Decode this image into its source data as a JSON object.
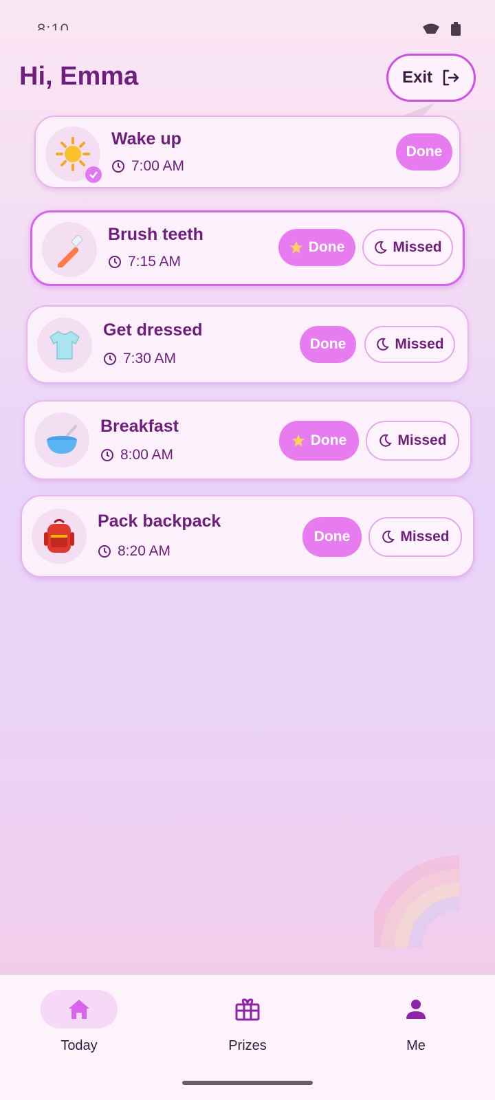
{
  "status_bar": {
    "time": "8:10"
  },
  "header": {
    "greeting": "Hi, Emma",
    "exit_label": "Exit"
  },
  "tasks": [
    {
      "title": "Wake up",
      "time": "7:00 AM",
      "icon": "sun-icon",
      "completed": true,
      "done_label": "Done",
      "missed_label": ""
    },
    {
      "title": "Brush teeth",
      "time": "7:15 AM",
      "icon": "toothbrush-icon",
      "starred": true,
      "done_label": "Done",
      "missed_label": "Missed"
    },
    {
      "title": "Get dressed",
      "time": "7:30 AM",
      "icon": "tshirt-icon",
      "done_label": "Done",
      "missed_label": "Missed"
    },
    {
      "title": "Breakfast",
      "time": "8:00 AM",
      "icon": "bowl-icon",
      "starred": true,
      "done_label": "Done",
      "missed_label": "Missed"
    },
    {
      "title": "Pack backpack",
      "time": "8:20 AM",
      "icon": "backpack-icon",
      "done_label": "Done",
      "missed_label": "Missed"
    }
  ],
  "nav": {
    "items": [
      {
        "label": "Today",
        "icon": "home-icon",
        "selected": true
      },
      {
        "label": "Prizes",
        "icon": "gift-icon",
        "selected": false
      },
      {
        "label": "Me",
        "icon": "person-icon",
        "selected": false
      }
    ]
  },
  "colors": {
    "primary": "#6e1e7c",
    "accent": "#e67cef",
    "card": "#fcf0fb",
    "border": "#e8b4ee"
  }
}
